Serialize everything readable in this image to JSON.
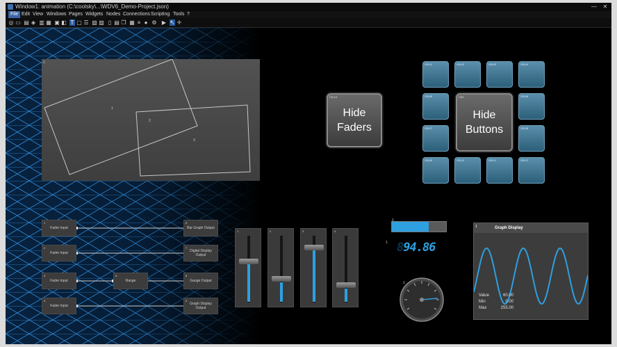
{
  "window": {
    "title": "Window1: animation (C:\\coolsky\\...\\WDV6_Demo-Project.json)",
    "minimize": "—",
    "close": "✕"
  },
  "menu": [
    "File",
    "Edit",
    "View",
    "Windows",
    "Pages",
    "Widgets",
    "Nodes",
    "Connections",
    "Scripting",
    "Tools",
    "?"
  ],
  "canvas": {
    "image_widget": {
      "index": "1",
      "label_a": "1",
      "label_b": "2",
      "label_c": "3"
    },
    "hide_faders": {
      "tag": "CB:16",
      "label": "Hide\nFaders"
    },
    "hide_buttons": {
      "tag": "CB0",
      "label": "Hide\nButtons"
    },
    "tiles": [
      {
        "tag": "CB:01"
      },
      {
        "tag": "CB:02"
      },
      {
        "tag": "CB:03"
      },
      {
        "tag": "CB:04"
      },
      {
        "tag": "CB:05"
      },
      {
        "tag": "CB:06"
      },
      {
        "tag": "CB:07"
      },
      {
        "tag": "CB:08"
      },
      {
        "tag": "CB:09"
      },
      {
        "tag": "CB:10"
      },
      {
        "tag": "CB:11"
      },
      {
        "tag": "CB:12"
      }
    ],
    "nodes": {
      "left": [
        {
          "index": "1",
          "label": "Fader Input"
        },
        {
          "index": "2",
          "label": "Fader Input"
        },
        {
          "index": "3",
          "label": "Fader Input"
        },
        {
          "index": "4",
          "label": "Fader Input"
        }
      ],
      "middle": {
        "index": "5",
        "label": "Range"
      },
      "right": [
        {
          "index": "6",
          "label": "Bar Graph Output"
        },
        {
          "index": "7",
          "label": "Digital Display Output"
        },
        {
          "index": "8",
          "label": "Gauge Output"
        },
        {
          "index": "9",
          "label": "Graph Display Output"
        }
      ]
    },
    "faders": [
      {
        "index": "1",
        "level": 0.62
      },
      {
        "index": "2",
        "level": 0.32
      },
      {
        "index": "3",
        "level": 0.85
      },
      {
        "index": "4",
        "level": 0.22
      }
    ],
    "progress": {
      "index": "1",
      "value": 0.68
    },
    "digital_display": {
      "index": "1",
      "ghost": "8",
      "value": "94.86"
    },
    "gauge": {
      "index": "1"
    },
    "graph": {
      "index": "1",
      "title": "Graph Display",
      "value_label": "Value",
      "value": "60.00",
      "min_label": "Min",
      "min": "0.00",
      "max_label": "Max",
      "max": "255.00"
    }
  },
  "colors": {
    "accent": "#2ea0e0",
    "tile": "#3f7896",
    "grid": "#1e6fb5"
  }
}
